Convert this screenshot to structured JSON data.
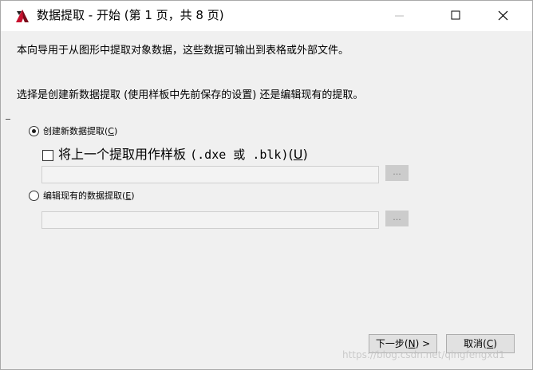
{
  "window": {
    "title": "数据提取 - 开始 (第 1 页，共 8 页)",
    "controls": {
      "minimize": "minimize",
      "maximize": "maximize",
      "close": "close"
    }
  },
  "intro": {
    "line1": "本向导用于从图形中提取对象数据，这些数据可输出到表格或外部文件。",
    "line2": "选择是创建新数据提取 (使用样板中先前保存的设置) 还是编辑现有的提取。"
  },
  "options": {
    "create_new": {
      "label": "创建新数据提取",
      "hotkey": "C",
      "selected": true
    },
    "use_template": {
      "label": "将上一个提取用作样板",
      "formats": "(.dxe 或 .blk)",
      "hotkey": "U",
      "checked": false
    },
    "template_path": {
      "value": "",
      "browse_label": "..."
    },
    "edit_existing": {
      "label": "编辑现有的数据提取",
      "hotkey": "E",
      "selected": false
    },
    "existing_path": {
      "value": "",
      "browse_label": "..."
    }
  },
  "buttons": {
    "next": {
      "label": "下一步",
      "hotkey": "N",
      "suffix": " >"
    },
    "cancel": {
      "label": "取消",
      "hotkey": "C"
    }
  },
  "watermark": "https://blog.csdn.net/qingfengxd1",
  "colors": {
    "dialog_bg": "#f0f0f0",
    "titlebar_bg": "#ffffff",
    "button_bg": "#e1e1e1",
    "disabled_bg": "#cccccc",
    "icon_red": "#c8102e"
  }
}
